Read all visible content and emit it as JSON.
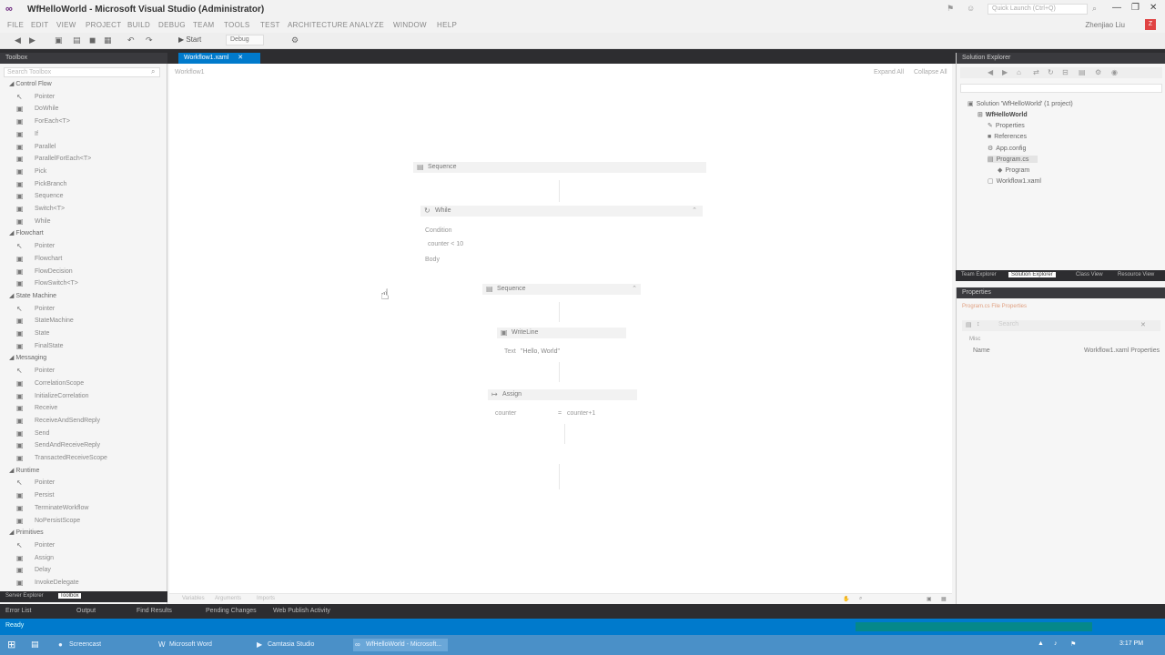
{
  "window": {
    "title": "WfHelloWorld - Microsoft Visual Studio (Administrator)",
    "quick_launch_placeholder": "Quick Launch (Ctrl+Q)",
    "user": "Zhenjiao Liu",
    "avatar_initial": "Z"
  },
  "menu": [
    "FILE",
    "EDIT",
    "VIEW",
    "PROJECT",
    "BUILD",
    "DEBUG",
    "TEAM",
    "TOOLS",
    "TEST",
    "ARCHITECTURE",
    "ANALYZE",
    "WINDOW",
    "HELP"
  ],
  "toolbar": {
    "start_label": "Start",
    "config": "Debug"
  },
  "toolbox": {
    "title": "Toolbox",
    "search_placeholder": "Search Toolbox",
    "categories": [
      {
        "name": "Control Flow",
        "items": [
          "Pointer",
          "DoWhile",
          "ForEach<T>",
          "If",
          "Parallel",
          "ParallelForEach<T>",
          "Pick",
          "PickBranch",
          "Sequence",
          "Switch<T>",
          "While"
        ]
      },
      {
        "name": "Flowchart",
        "items": [
          "Pointer",
          "Flowchart",
          "FlowDecision",
          "FlowSwitch<T>"
        ]
      },
      {
        "name": "State Machine",
        "items": [
          "Pointer",
          "StateMachine",
          "State",
          "FinalState"
        ]
      },
      {
        "name": "Messaging",
        "items": [
          "Pointer",
          "CorrelationScope",
          "InitializeCorrelation",
          "Receive",
          "ReceiveAndSendReply",
          "Send",
          "SendAndReceiveReply",
          "TransactedReceiveScope"
        ]
      },
      {
        "name": "Runtime",
        "items": [
          "Pointer",
          "Persist",
          "TerminateWorkflow",
          "NoPersistScope"
        ]
      },
      {
        "name": "Primitives",
        "items": [
          "Pointer",
          "Assign",
          "Delay",
          "InvokeDelegate"
        ]
      }
    ],
    "bottom_tabs": [
      "Server Explorer",
      "Toolbox"
    ]
  },
  "document": {
    "tab": "Workflow1.xaml",
    "breadcrumb": "Workflow1",
    "expand_all": "Expand All",
    "collapse_all": "Collapse All"
  },
  "workflow": {
    "outer_sequence": "Sequence",
    "while_title": "While",
    "condition_label": "Condition",
    "condition_value": "counter < 10",
    "body_label": "Body",
    "inner_sequence": "Sequence",
    "writeline_title": "WriteLine",
    "writeline_text_label": "Text",
    "writeline_text_value": "\"Hello, World\"",
    "assign_title": "Assign",
    "assign_to": "counter",
    "assign_value": "counter+1"
  },
  "designer_bar": [
    "Variables",
    "Arguments",
    "Imports"
  ],
  "solution_explorer": {
    "title": "Solution Explorer",
    "items": [
      {
        "label": "Solution 'WfHelloWorld' (1 project)",
        "level": 0,
        "icon": "solution-icon"
      },
      {
        "label": "WfHelloWorld",
        "level": 1,
        "icon": "project-icon",
        "bold": true
      },
      {
        "label": "Properties",
        "level": 2,
        "icon": "wrench-icon"
      },
      {
        "label": "References",
        "level": 2,
        "icon": "references-icon"
      },
      {
        "label": "App.config",
        "level": 2,
        "icon": "config-icon"
      },
      {
        "label": "Program.cs",
        "level": 2,
        "icon": "cs-icon",
        "selected": true
      },
      {
        "label": "Program",
        "level": 3,
        "icon": "class-icon"
      },
      {
        "label": "Workflow1.xaml",
        "level": 2,
        "icon": "xaml-icon"
      }
    ],
    "tabs": [
      "Team Explorer",
      "Solution Explorer",
      "Class View",
      "Resource View"
    ]
  },
  "properties": {
    "title": "Properties",
    "object": "Program.cs File Properties",
    "search_placeholder": "Search",
    "category": "Misc",
    "prop_name": "Name",
    "prop_value": "Workflow1.xaml Properties"
  },
  "bottom_tabs": [
    "Error List",
    "Output",
    "Find Results",
    "Pending Changes",
    "Web Publish Activity"
  ],
  "status": {
    "ready": "Ready"
  },
  "taskbar": {
    "items": [
      "Screencast",
      "Microsoft Word",
      "Camtasia Studio",
      "WfHelloWorld - Microsoft..."
    ],
    "time": "3:17 PM"
  }
}
